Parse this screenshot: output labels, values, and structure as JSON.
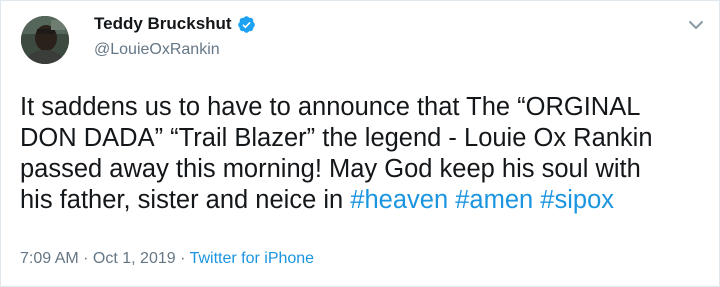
{
  "author": {
    "display_name": "Teddy Bruckshut",
    "handle": "@LouieOxRankin",
    "verified": true,
    "avatar_icon": "user-avatar-photo"
  },
  "menu_icon": "chevron-down-icon",
  "tweet": {
    "lines": [
      "It saddens us to have to announce that The “ORGINAL",
      "DON DADA” “Trail Blazer” the legend - Louie Ox Rankin",
      "passed away this morning! May God keep his soul with",
      "his father, sister and neice in "
    ],
    "hashtags": [
      "#heaven",
      "#amen",
      "#sipox"
    ]
  },
  "meta": {
    "time": "7:09 AM",
    "separator": " · ",
    "date": "Oct 1, 2019",
    "separator2": " · ",
    "source": "Twitter for iPhone"
  },
  "colors": {
    "link": "#1b95e0",
    "secondary_text": "#657786",
    "verified": "#1da1f2"
  }
}
